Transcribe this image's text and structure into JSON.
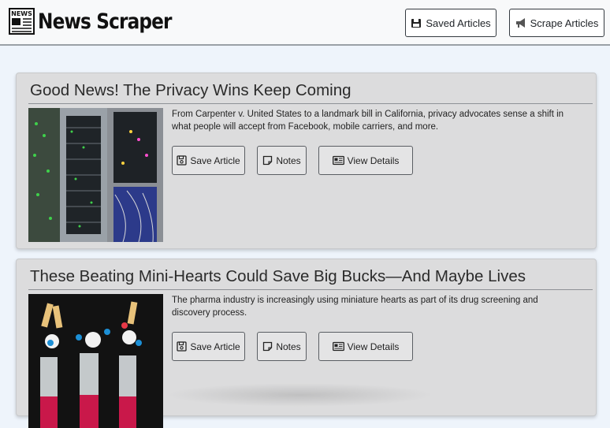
{
  "header": {
    "logo_text": "NEWS",
    "brand": "News Scraper",
    "saved_label": "Saved Articles",
    "scrape_label": "Scrape Articles"
  },
  "articles": [
    {
      "title": "Good News! The Privacy Wins Keep Coming",
      "summary": "From Carpenter v. United States to a landmark bill in California, privacy advocates sense a shift in what people will accept from Facebook, mobile carriers, and more.",
      "save_label": "Save Article",
      "notes_label": "Notes",
      "details_label": "View Details",
      "image": "server-rack-image"
    },
    {
      "title": "These Beating Mini-Hearts Could Save Big Bucks—And Maybe Lives",
      "summary": "The pharma industry is increasingly using miniature hearts as part of its drug screening and discovery process.",
      "save_label": "Save Article",
      "notes_label": "Notes",
      "details_label": "View Details",
      "image": "mini-hearts-lab-image"
    }
  ],
  "icons": {
    "saved": "save-download-icon",
    "scrape": "scrape-megaphone-icon",
    "save": "floppy-disk-icon",
    "notes": "sticky-note-icon",
    "details": "newspaper-icon"
  }
}
